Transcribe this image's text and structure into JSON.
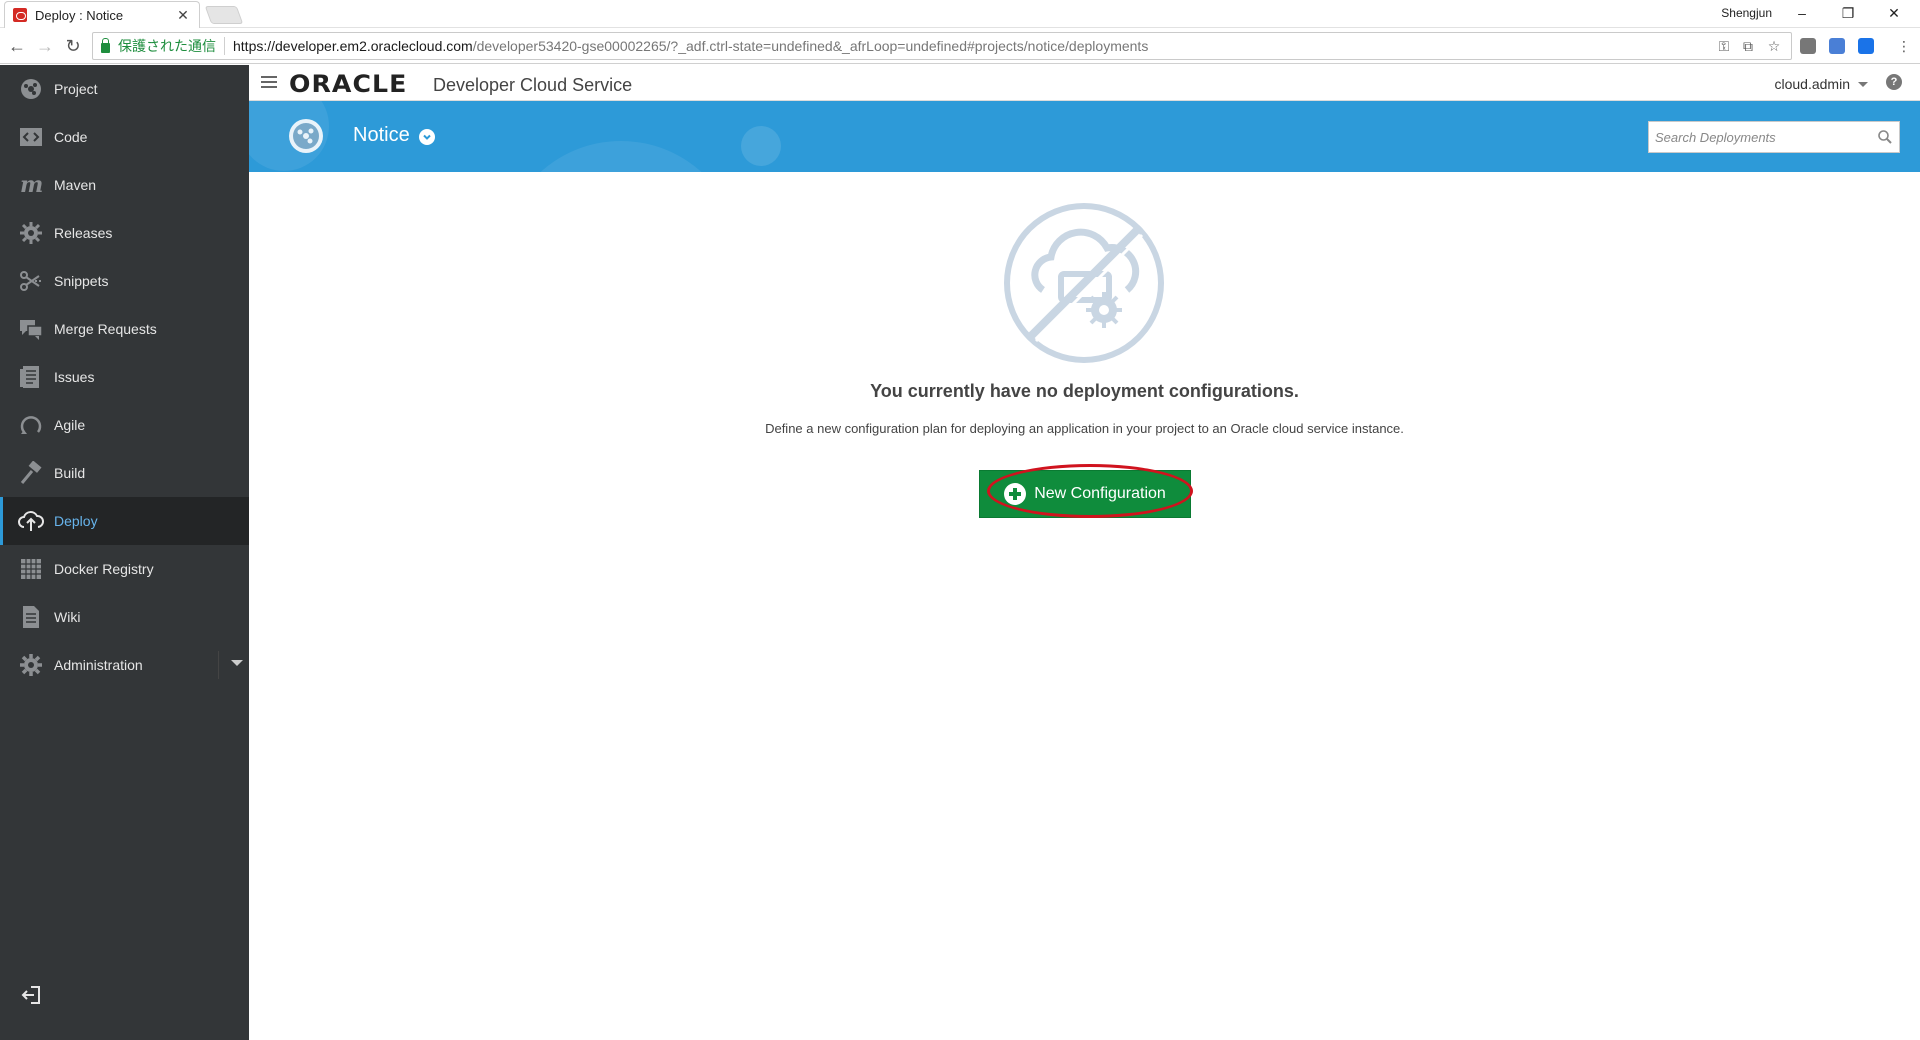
{
  "browser": {
    "tab_title": "Deploy : Notice",
    "tab_close": "✕",
    "profile_name": "Shengjun",
    "secure_label": "保護された通信",
    "url_host": "https://developer.em2.oraclecloud.com",
    "url_path": "/developer53420-gse00002265/?_adf.ctrl-state=undefined&_afrLoop=undefined#projects/notice/deployments"
  },
  "header": {
    "logo": "ORACLE",
    "product": "Developer Cloud Service",
    "user": "cloud.admin",
    "help": "?"
  },
  "banner": {
    "project_name": "Notice",
    "search_placeholder": "Search Deployments"
  },
  "sidebar": {
    "items": [
      {
        "label": "Project",
        "icon": "project-icon"
      },
      {
        "label": "Code",
        "icon": "code-icon"
      },
      {
        "label": "Maven",
        "icon": "maven-icon"
      },
      {
        "label": "Releases",
        "icon": "releases-icon"
      },
      {
        "label": "Snippets",
        "icon": "snippets-icon"
      },
      {
        "label": "Merge Requests",
        "icon": "merge-requests-icon"
      },
      {
        "label": "Issues",
        "icon": "issues-icon"
      },
      {
        "label": "Agile",
        "icon": "agile-icon"
      },
      {
        "label": "Build",
        "icon": "build-icon"
      },
      {
        "label": "Deploy",
        "icon": "deploy-icon",
        "active": true
      },
      {
        "label": "Docker Registry",
        "icon": "docker-registry-icon"
      },
      {
        "label": "Wiki",
        "icon": "wiki-icon"
      },
      {
        "label": "Administration",
        "icon": "administration-icon"
      }
    ]
  },
  "main": {
    "empty_title": "You currently have no deployment configurations.",
    "empty_description": "Define a new configuration plan for deploying an application in your project to an Oracle cloud service instance.",
    "new_config_label": "New Configuration"
  },
  "colors": {
    "banner": "#2d9ad8",
    "sidebar": "#333638",
    "active_text": "#67b4ec",
    "button_green": "#0f8c3c",
    "highlight_red": "#d0131e"
  }
}
